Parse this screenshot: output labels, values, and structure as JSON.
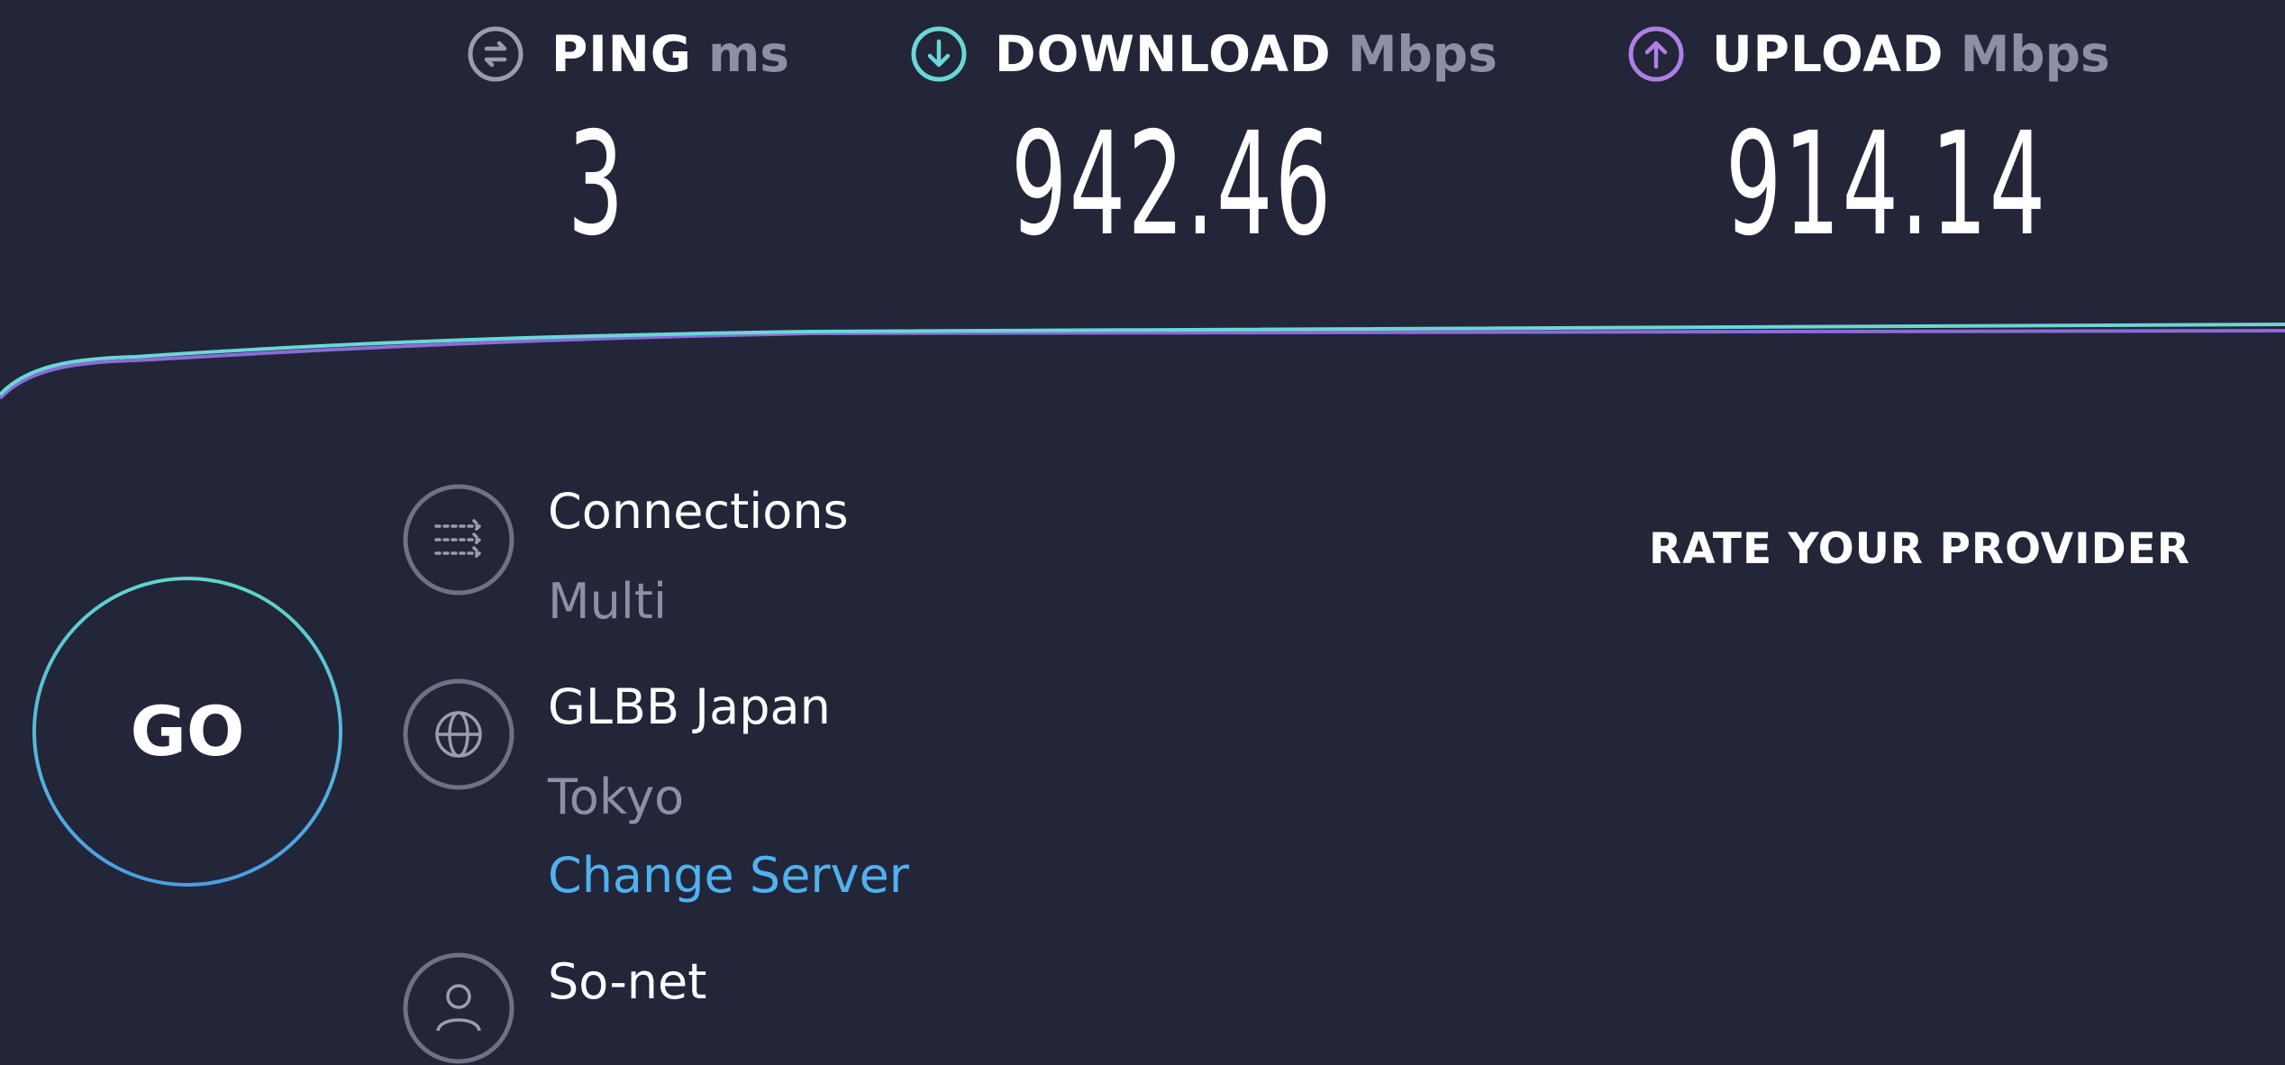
{
  "results": {
    "ping": {
      "label": "PING",
      "unit": "ms",
      "value": "3",
      "icon": "ping-icon",
      "color": "#9b9cae"
    },
    "download": {
      "label": "DOWNLOAD",
      "unit": "Mbps",
      "value": "942.46",
      "icon": "download-arrow-icon",
      "color": "#6ad7d7"
    },
    "upload": {
      "label": "UPLOAD",
      "unit": "Mbps",
      "value": "914.14",
      "icon": "upload-arrow-icon",
      "color": "#b07fe4"
    }
  },
  "go_button": {
    "label": "GO"
  },
  "connection_info": {
    "connections": {
      "title": "Connections",
      "value": "Multi",
      "icon": "connections-icon"
    },
    "server": {
      "title": "GLBB Japan",
      "location": "Tokyo",
      "change_label": "Change Server",
      "icon": "globe-icon"
    },
    "provider": {
      "title": "So-net",
      "icon": "user-icon"
    }
  },
  "rate_provider": {
    "label": "RATE YOUR PROVIDER"
  },
  "colors": {
    "background": "#232538",
    "download_line": "#6ad7d7",
    "upload_line": "#8b6bd8",
    "link": "#4fb1ef",
    "muted": "#8d8fa6"
  }
}
